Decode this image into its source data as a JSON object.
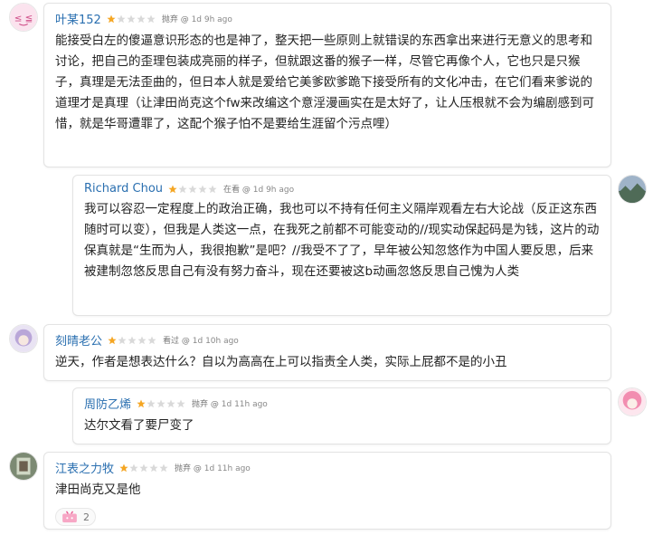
{
  "colors": {
    "username": "#2a6fb0",
    "star_active": "#f5a623",
    "star_inactive": "#d9d9d9",
    "bubble_border": "#e3e3e3"
  },
  "comments": [
    {
      "username": "叶某152",
      "rating": 1,
      "status": "抛弃",
      "time": "1d 9h ago",
      "avatar_icon": "pink-face-avatar",
      "text": "能接受白左的傻逼意识形态的也是神了，整天把一些原则上就错误的东西拿出来进行无意义的思考和讨论，把自己的歪理包装成亮丽的样子，但就跟这番的猴子一样，尽管它再像个人，它也只是只猴子，真理是无法歪曲的，但日本人就是爱给它美爹欧爹跪下接受所有的文化冲击，在它们看来爹说的道理才是真理（让津田尚克这个fw来改编这个意淫漫画实在是太好了，让人压根就不会为编剧感到可惜，就是华哥遭罪了，这配个猴子怕不是要给生涯留个污点哩）"
    },
    {
      "username": "Richard Chou",
      "rating": 1,
      "status": "在看",
      "time": "1d 9h ago",
      "avatar_icon": "landscape-avatar",
      "text": "我可以容忍一定程度上的政治正确，我也可以不持有任何主义隔岸观看左右大论战（反正这东西随时可以变），但我是人类这一点，在我死之前都不可能变动的//现实动保起码是为钱，这片的动保真就是“生而为人，我很抱歉”是吧？//我受不了了，早年被公知忽悠作为中国人要反思，后来被建制忽悠反思自己有没有努力奋斗，现在还要被这b动画忽悠反思自己愧为人类"
    },
    {
      "username": "刻晴老公",
      "rating": 1,
      "status": "看过",
      "time": "1d 10h ago",
      "avatar_icon": "anime-girl-avatar",
      "text": "逆天，作者是想表达什么？自以为高高在上可以指责全人类，实际上屁都不是的小丑"
    },
    {
      "username": "周防乙烯",
      "rating": 1,
      "status": "抛弃",
      "time": "1d 11h ago",
      "avatar_icon": "pink-hair-avatar",
      "text": "达尔文看了要尸变了"
    },
    {
      "username": "江表之力牧",
      "rating": 1,
      "status": "抛弃",
      "time": "1d 11h ago",
      "avatar_icon": "photo-avatar",
      "text": "津田尚克又是他",
      "reaction": {
        "icon": "bilibili-tv-icon",
        "count": "2"
      }
    }
  ]
}
